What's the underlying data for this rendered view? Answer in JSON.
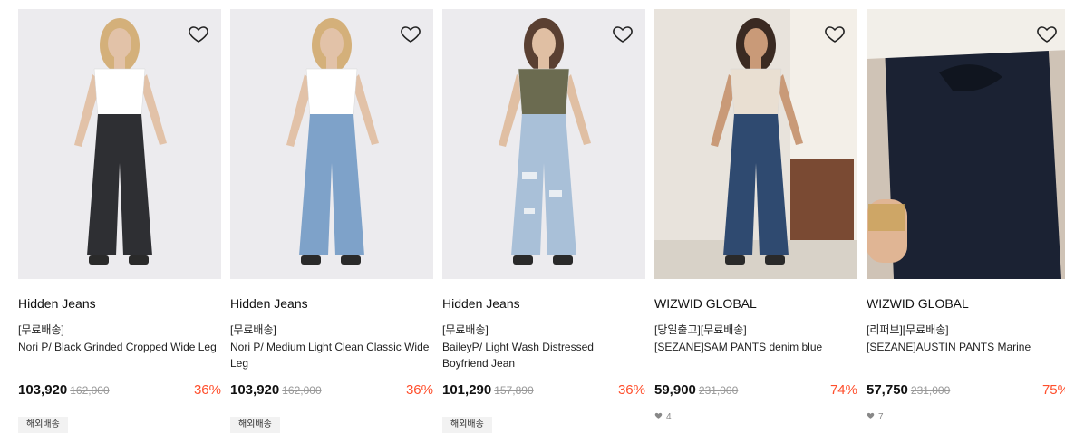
{
  "products": [
    {
      "brand": "Hidden Jeans",
      "tag": "[무료배송]",
      "name": "Nori P/ Black Grinded Cropped Wide Leg",
      "price": "103,920",
      "original_price": "162,000",
      "discount": "36%",
      "shipping_badge": "해외배송",
      "likes": null,
      "wishlist_icon": "heart-outline-icon",
      "colors": {
        "bg": "#ecebee",
        "top": "#ffffff",
        "jeans": "#2e2f33",
        "skin": "#e2c2a8",
        "hair": "#d4b07a"
      }
    },
    {
      "brand": "Hidden Jeans",
      "tag": "[무료배송]",
      "name": "Nori P/ Medium Light Clean Classic Wide Leg",
      "price": "103,920",
      "original_price": "162,000",
      "discount": "36%",
      "shipping_badge": "해외배송",
      "likes": null,
      "wishlist_icon": "heart-outline-icon",
      "colors": {
        "bg": "#ecebee",
        "top": "#ffffff",
        "jeans": "#7ea2c9",
        "skin": "#e2c2a8",
        "hair": "#d4b07a"
      }
    },
    {
      "brand": "Hidden Jeans",
      "tag": "[무료배송]",
      "name": "BaileyP/ Light Wash Distressed Boyfriend Jean",
      "price": "101,290",
      "original_price": "157,890",
      "discount": "36%",
      "shipping_badge": "해외배송",
      "likes": null,
      "wishlist_icon": "heart-outline-icon",
      "colors": {
        "bg": "#ecebee",
        "top": "#6b6b50",
        "jeans": "#a9c0d8",
        "skin": "#e0bfa3",
        "hair": "#5a4032"
      }
    },
    {
      "brand": "WIZWID GLOBAL",
      "tag": "[당일출고][무료배송]",
      "name": "[SEZANE]SAM PANTS denim blue",
      "price": "59,900",
      "original_price": "231,000",
      "discount": "74%",
      "shipping_badge": null,
      "likes": "4",
      "wishlist_icon": "heart-outline-icon",
      "colors": {
        "bg": "#e8e3dc",
        "top": "#e9dfd2",
        "jeans": "#2f4a70",
        "skin": "#c99a78",
        "hair": "#3a2a22"
      }
    },
    {
      "brand": "WIZWID GLOBAL",
      "tag": "[리퍼브][무료배송]",
      "name": "[SEZANE]AUSTIN PANTS Marine",
      "price": "57,750",
      "original_price": "231,000",
      "discount": "75%",
      "shipping_badge": null,
      "likes": "7",
      "wishlist_icon": "heart-outline-icon",
      "colors": {
        "bg": "#d9cfc4",
        "top": "#f2efe9",
        "jeans": "#1b2233",
        "skin": "#e0b594",
        "hair": "#1b2233"
      }
    }
  ]
}
